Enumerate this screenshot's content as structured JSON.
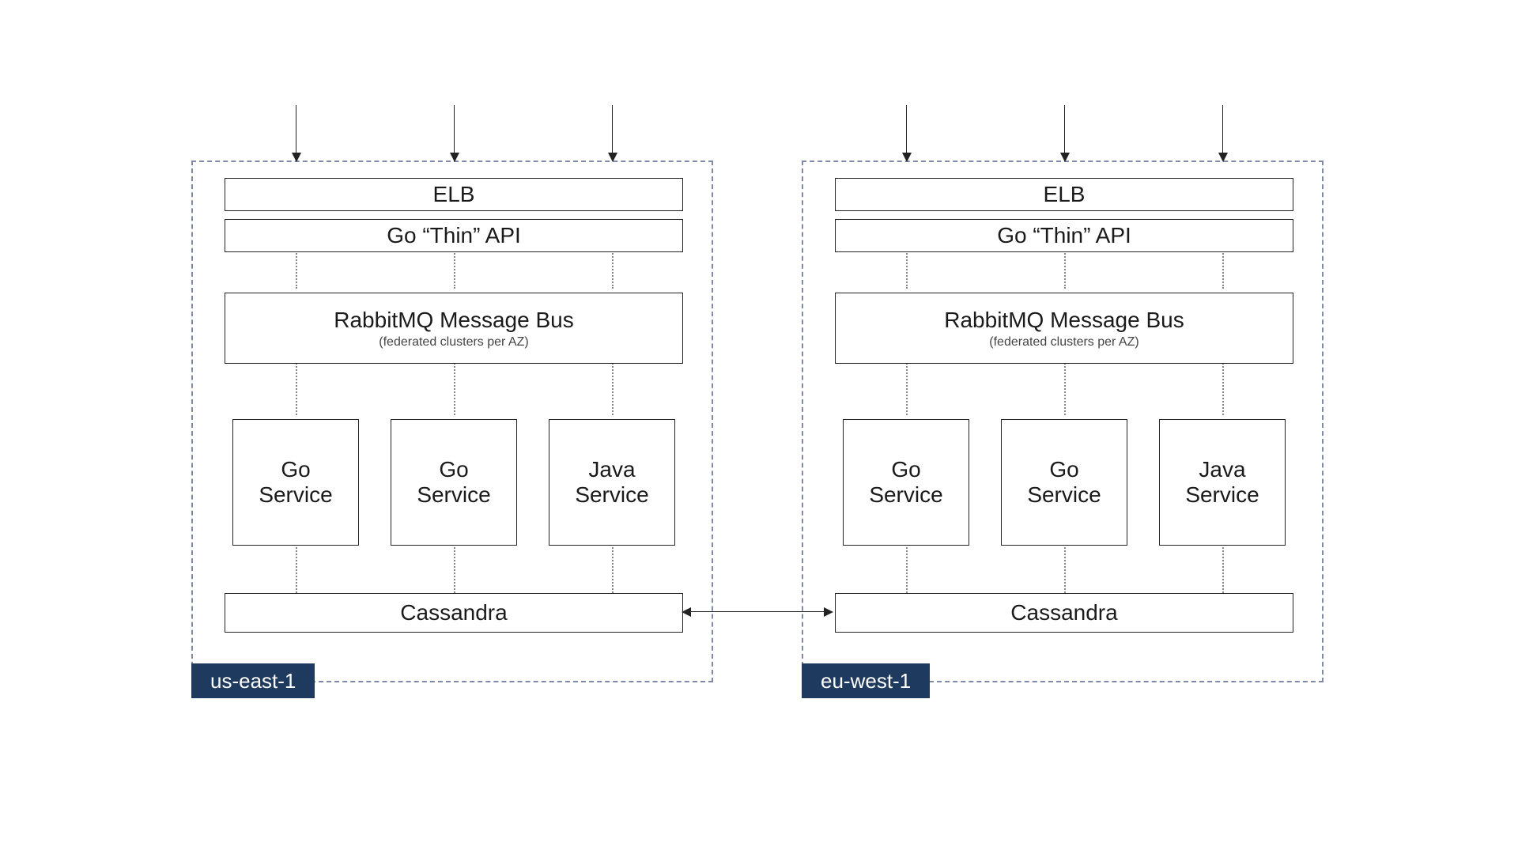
{
  "regions": [
    {
      "name": "us-east-1"
    },
    {
      "name": "eu-west-1"
    }
  ],
  "layers": {
    "elb": "ELB",
    "api": "Go “Thin” API",
    "bus_title": "RabbitMQ Message Bus",
    "bus_sub": "(federated clusters per AZ)",
    "services": [
      {
        "line1": "Go",
        "line2": "Service"
      },
      {
        "line1": "Go",
        "line2": "Service"
      },
      {
        "line1": "Java",
        "line2": "Service"
      }
    ],
    "db": "Cassandra"
  }
}
